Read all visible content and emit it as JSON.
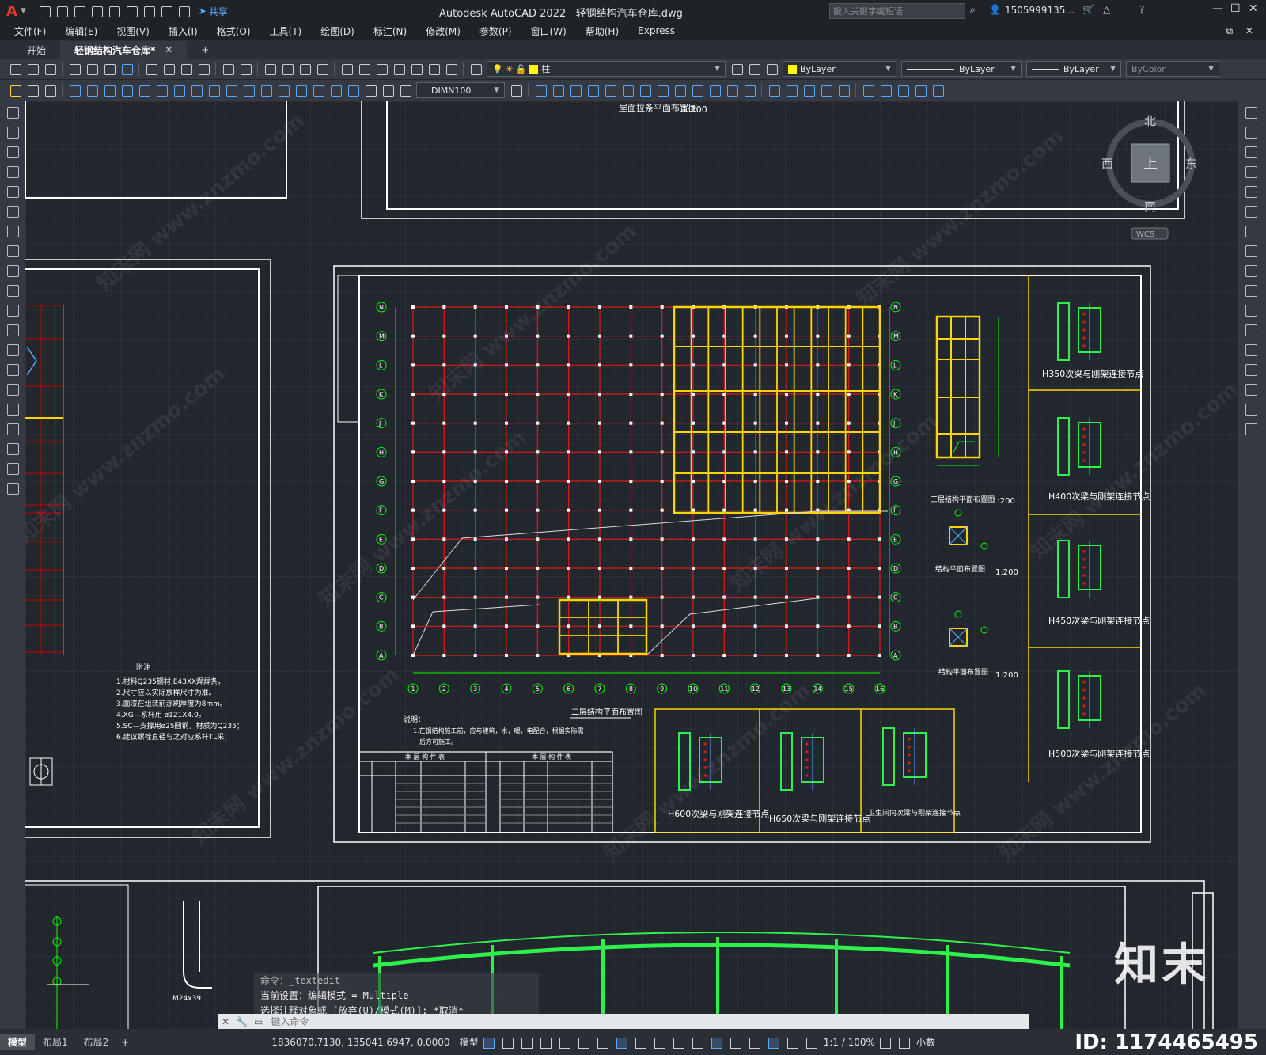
{
  "app_title": "Autodesk AutoCAD 2022",
  "file_title": "轻钢结构汽车仓库.dwg",
  "search_placeholder": "键入关键字或短语",
  "user_name": "1505999135...",
  "share_label": "共享",
  "menus": [
    "文件(F)",
    "编辑(E)",
    "视图(V)",
    "插入(I)",
    "格式(O)",
    "工具(T)",
    "绘图(D)",
    "标注(N)",
    "修改(M)",
    "参数(P)",
    "窗口(W)",
    "帮助(H)",
    "Express"
  ],
  "tabs": [
    {
      "label": "开始"
    },
    {
      "label": "轻钢结构汽车仓库*"
    }
  ],
  "toolbar": {
    "layer_name": "柱",
    "color": "ByLayer",
    "linetype": "ByLayer",
    "lineweight": "ByLayer",
    "plotstyle": "ByColor",
    "dimstyle": "DIMN100"
  },
  "viewcube": {
    "north": "北",
    "south": "南",
    "east": "东",
    "west": "西",
    "top": "上",
    "wcs": "WCS"
  },
  "drawing_titles": {
    "roof_support": "屋面拉条平面布置图",
    "roof_support_scale": "1:200",
    "second_floor": "二层结构平面布置图",
    "third_floor": "三层结构平面布置图",
    "third_scale": "1:200",
    "struct_plan_a": "结构平面布置图",
    "struct_plan_a_scale": "1:200",
    "struct_plan_b": "结构平面布置图",
    "struct_plan_b_scale": "1:200",
    "notes_title": "附注",
    "notes": [
      "1.材料Q235钢材,E43XX焊焊条。",
      "2.尺寸应以实际放样尺寸为准。",
      "3.面漆在组装前涂刷厚度为8mm。",
      "4.XG—系杆用 ø121X4.0。",
      "5.SC—支撑用ø25圆钢，材质为Q235；",
      "6.建议螺栓直径与之对应系杆TL采；"
    ],
    "explain_title": "说明：",
    "explain": "1.在钢结构施工前，应与建筑，水，暖，电配合，根据实际需",
    "explain2": "后方可施工。",
    "members_table_title_1": "本 层 构 件 表",
    "members_table_title_2": "本 层 构 件 表"
  },
  "nodes": [
    {
      "label": "H350次梁与刚架连接节点"
    },
    {
      "label": "H400次梁与刚架连接节点"
    },
    {
      "label": "H450次梁与刚架连接节点"
    },
    {
      "label": "H500次梁与刚架连接节点"
    },
    {
      "label": "H600次梁与刚架连接节点"
    },
    {
      "label": "H650次梁与刚架连接节点"
    },
    {
      "label": "卫生间内次梁与刚架连接节点"
    }
  ],
  "grid_rows": [
    "N",
    "M",
    "L",
    "K",
    "J",
    "H",
    "G",
    "F",
    "E",
    "D",
    "C",
    "B",
    "A"
  ],
  "grid_cols": [
    "1",
    "2",
    "3",
    "4",
    "5",
    "6",
    "7",
    "8",
    "9",
    "10",
    "11",
    "12",
    "13",
    "14",
    "15",
    "16"
  ],
  "bolt_label": "M24x39",
  "command": {
    "lines": [
      "命令：_textedit",
      "当前设置：编辑模式 = Multiple",
      "选择注释对象或 [放弃(U)/模式(M)]: *取消*"
    ],
    "placeholder": "键入命令"
  },
  "watermark": "知末网 www.znzmo.com",
  "brand": "知末",
  "brand_id": "ID: 1174465495",
  "layout_tabs": [
    "模型",
    "布局1",
    "布局2"
  ],
  "status": {
    "coords": "1836070.7130, 135041.6947, 0.0000",
    "model": "模型",
    "scale": "1:1 / 100%",
    "units": "小数"
  }
}
